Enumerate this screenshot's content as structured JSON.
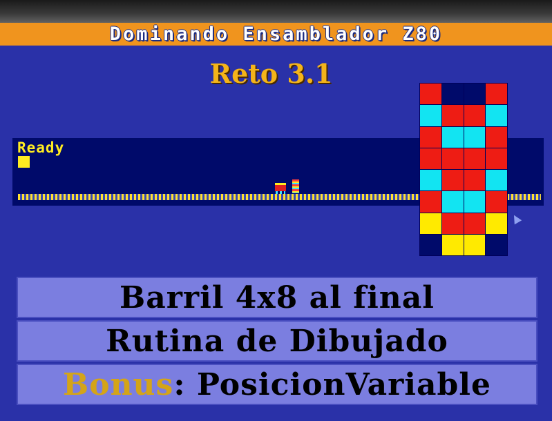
{
  "header": {
    "title": "Dominando Ensamblador Z80"
  },
  "challenge": {
    "label": "Reto 3.1"
  },
  "screen": {
    "prompt": "Ready"
  },
  "barrel_sprite": {
    "colors": {
      "R": "#ee1c14",
      "C": "#12e4f2",
      "Y": "#ffea00",
      "N": "#000a6a"
    },
    "rows": [
      [
        "R",
        "N",
        "N",
        "R"
      ],
      [
        "C",
        "R",
        "R",
        "C"
      ],
      [
        "R",
        "C",
        "C",
        "R"
      ],
      [
        "R",
        "R",
        "R",
        "R"
      ],
      [
        "C",
        "R",
        "R",
        "C"
      ],
      [
        "R",
        "C",
        "C",
        "R"
      ],
      [
        "Y",
        "R",
        "R",
        "Y"
      ],
      [
        "N",
        "Y",
        "Y",
        "N"
      ]
    ]
  },
  "banners": {
    "line1": "Barril 4x8 al final",
    "line2": "Rutina de Dibujado",
    "bonus_word": "Bonus",
    "bonus_rest": ": PosicionVariable"
  }
}
